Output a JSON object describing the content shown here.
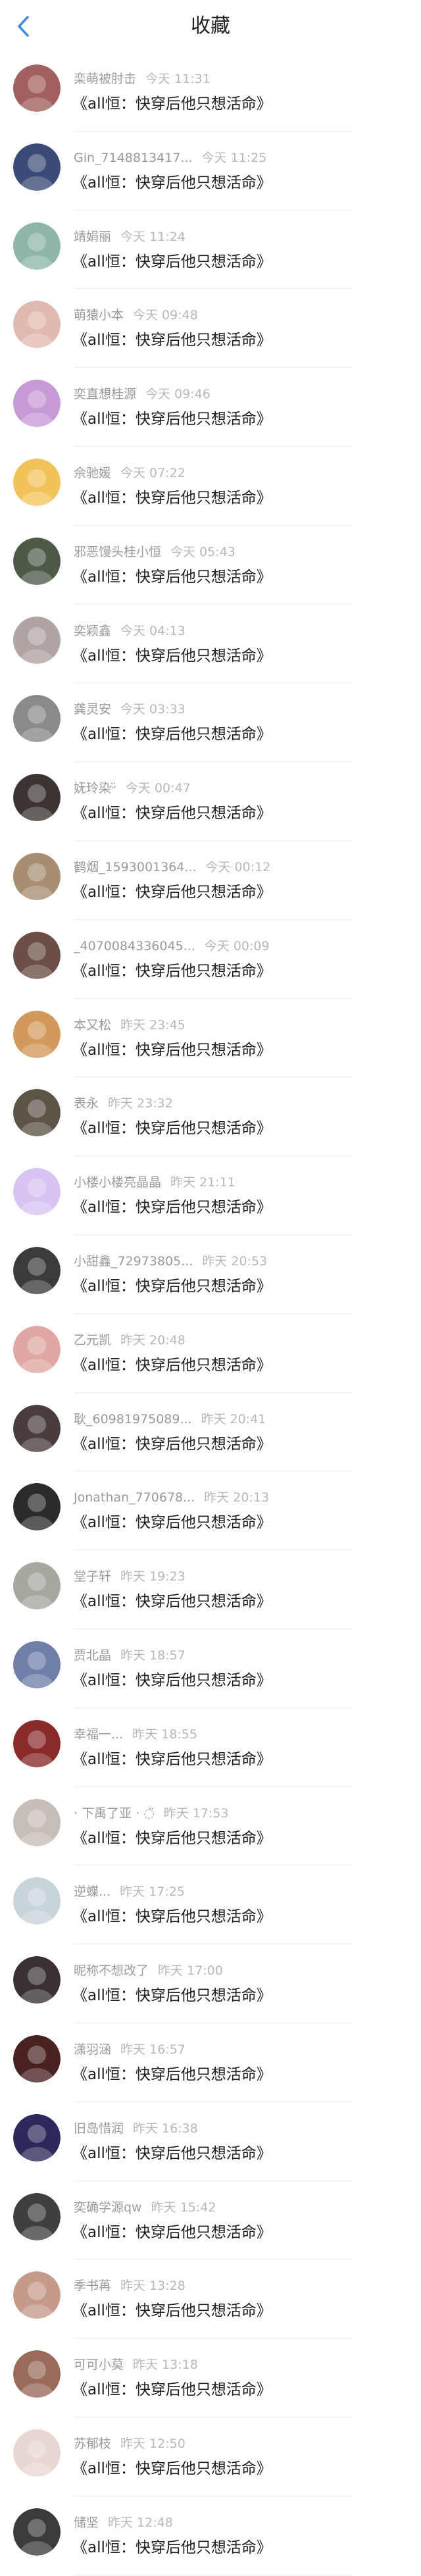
{
  "header": {
    "title": "收藏"
  },
  "colors": {
    "accent": "#3a8ee6",
    "name": "#9a9a9a",
    "time": "#b8b8b8",
    "message": "#1f1f1f"
  },
  "items": [
    {
      "name": "栾萌被肘击",
      "time": "今天 11:31",
      "message": "《all恒：快穿后他只想活命》",
      "avatar_color": "#a15f5f"
    },
    {
      "name": "Gin_7148813417...",
      "time": "今天 11:25",
      "message": "《all恒：快穿后他只想活命》",
      "avatar_color": "#3a4b78"
    },
    {
      "name": "靖娟丽",
      "time": "今天 11:24",
      "message": "《all恒：快穿后他只想活命》",
      "avatar_color": "#8fb6a7"
    },
    {
      "name": "萌猿小本",
      "time": "今天 09:48",
      "message": "《all恒：快穿后他只想活命》",
      "avatar_color": "#e2b9b0"
    },
    {
      "name": "奕直想桂源",
      "time": "今天 09:46",
      "message": "《all恒：快穿后他只想活命》",
      "avatar_color": "#c79ad6"
    },
    {
      "name": "佘驰媛",
      "time": "今天 07:22",
      "message": "《all恒：快穿后他只想活命》",
      "avatar_color": "#f2c35b"
    },
    {
      "name": "邪恶馒头桂小恒",
      "time": "今天 05:43",
      "message": "《all恒：快穿后他只想活命》",
      "avatar_color": "#4d5a48"
    },
    {
      "name": "奕颖鑫",
      "time": "今天 04:13",
      "message": "《all恒：快穿后他只想活命》",
      "avatar_color": "#b0a4a2"
    },
    {
      "name": "龚灵安",
      "time": "今天 03:33",
      "message": "《all恒：快穿后他只想活命》",
      "avatar_color": "#8a8a8a"
    },
    {
      "name": "妩玲染ᵕ̈",
      "time": "今天 00:47",
      "message": "《all恒：快穿后他只想活命》",
      "avatar_color": "#3c3432"
    },
    {
      "name": "鹤烟_1593001364...",
      "time": "今天 00:12",
      "message": "《all恒：快穿后他只想活命》",
      "avatar_color": "#a78e72"
    },
    {
      "name": "_4070084336045...",
      "time": "今天 00:09",
      "message": "《all恒：快穿后他只想活命》",
      "avatar_color": "#6b4e45"
    },
    {
      "name": "本又松",
      "time": "昨天 23:45",
      "message": "《all恒：快穿后他只想活命》",
      "avatar_color": "#d29a5a"
    },
    {
      "name": "表永",
      "time": "昨天 23:32",
      "message": "《all恒：快穿后他只想活命》",
      "avatar_color": "#5d5448"
    },
    {
      "name": "小楼小楼亮晶晶",
      "time": "昨天 21:11",
      "message": "《all恒：快穿后他只想活命》",
      "avatar_color": "#d8c4f2"
    },
    {
      "name": "小甜鑫_72973805...",
      "time": "昨天 20:53",
      "message": "《all恒：快穿后他只想活命》",
      "avatar_color": "#3b3b3b"
    },
    {
      "name": "乙元凯",
      "time": "昨天 20:48",
      "message": "《all恒：快穿后他只想活命》",
      "avatar_color": "#e1a7a2"
    },
    {
      "name": "耿_60981975089...",
      "time": "昨天 20:41",
      "message": "《all恒：快穿后他只想活命》",
      "avatar_color": "#4a3d3d"
    },
    {
      "name": "Jonathan_770678...",
      "time": "昨天 20:13",
      "message": "《all恒：快穿后他只想活命》",
      "avatar_color": "#2b2b2b"
    },
    {
      "name": "堂子轩",
      "time": "昨天 19:23",
      "message": "《all恒：快穿后他只想活命》",
      "avatar_color": "#a7a7a0"
    },
    {
      "name": "贾北晶",
      "time": "昨天 18:57",
      "message": "《all恒：快穿后他只想活命》",
      "avatar_color": "#6f7fa8"
    },
    {
      "name": "幸福一...",
      "time": "昨天 18:55",
      "message": "《all恒：快穿后他只想活命》",
      "avatar_color": "#8a2a2a"
    },
    {
      "name": "· 下禹了亚 · ◌̈",
      "time": "昨天 17:53",
      "message": "《all恒：快穿后他只想活命》",
      "avatar_color": "#c7bdb7"
    },
    {
      "name": "逆蝶...",
      "time": "昨天 17:25",
      "message": "《all恒：快穿后他只想活命》",
      "avatar_color": "#c9d3da"
    },
    {
      "name": "昵称不想改了",
      "time": "昨天 17:00",
      "message": "《all恒：快穿后他只想活命》",
      "avatar_color": "#3a3232"
    },
    {
      "name": "潇羽涵",
      "time": "昨天 16:57",
      "message": "《all恒：快穿后他只想活命》",
      "avatar_color": "#4a2222"
    },
    {
      "name": "旧岛惜润",
      "time": "昨天 16:38",
      "message": "《all恒：快穿后他只想活命》",
      "avatar_color": "#2c2a5a"
    },
    {
      "name": "奕确学源qw",
      "time": "昨天 15:42",
      "message": "《all恒：快穿后他只想活命》",
      "avatar_color": "#3f3f3f"
    },
    {
      "name": "季书苒",
      "time": "昨天 13:28",
      "message": "《all恒：快穿后他只想活命》",
      "avatar_color": "#c69a8a"
    },
    {
      "name": "可可小莫",
      "time": "昨天 13:18",
      "message": "《all恒：快穿后他只想活命》",
      "avatar_color": "#9a6a5a"
    },
    {
      "name": "苏郁枝",
      "time": "昨天 12:50",
      "message": "《all恒：快穿后他只想活命》",
      "avatar_color": "#e7d6d2"
    },
    {
      "name": "储坚",
      "time": "昨天 12:48",
      "message": "《all恒：快穿后他只想活命》",
      "avatar_color": "#3b3b3b"
    }
  ]
}
